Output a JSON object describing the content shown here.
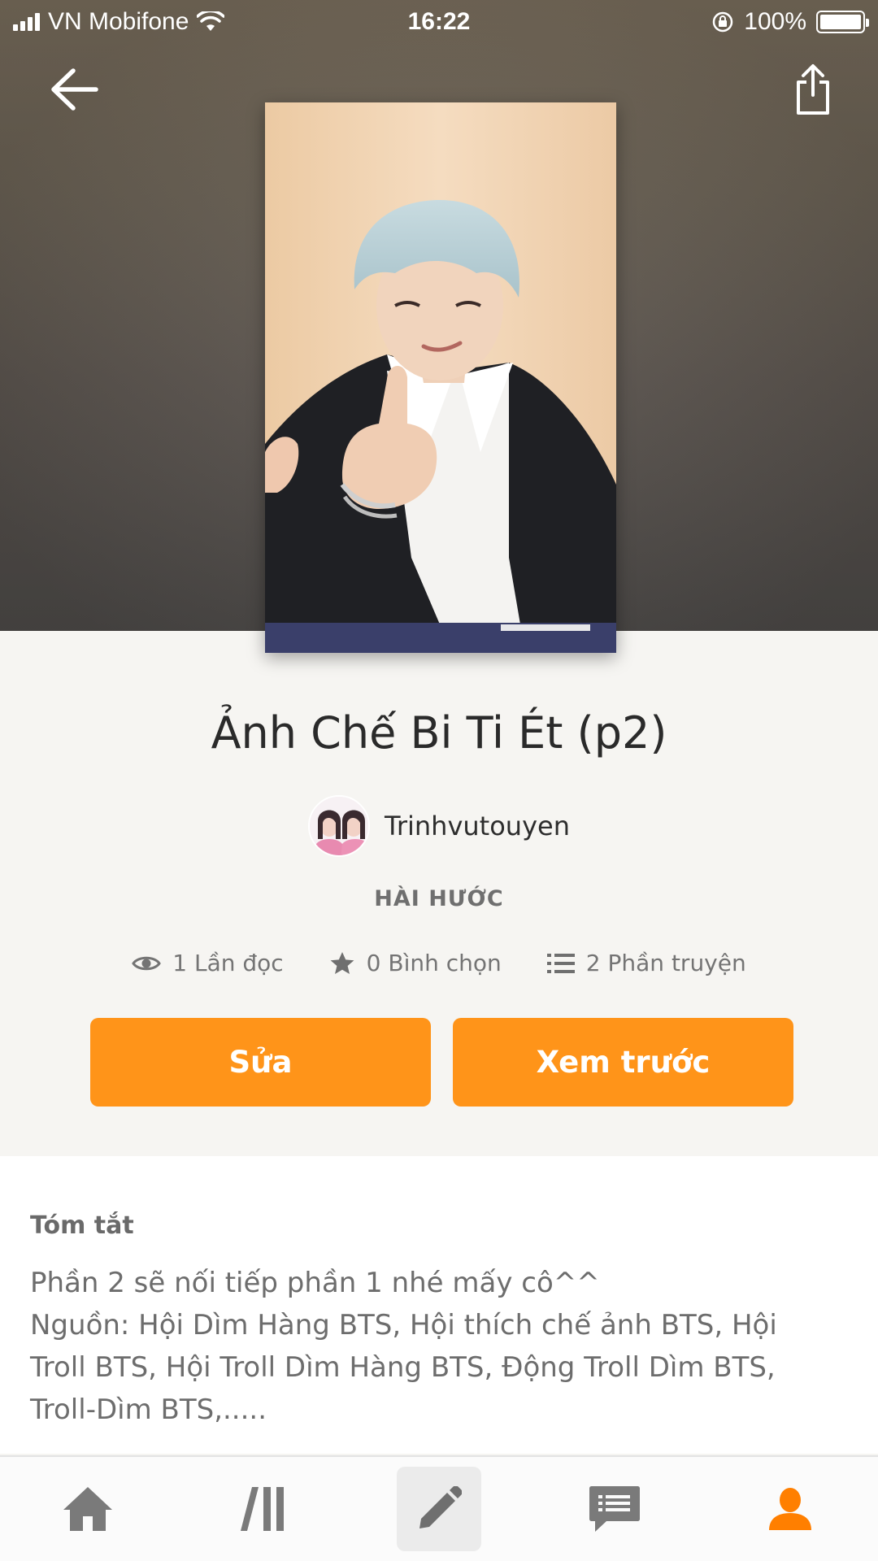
{
  "status_bar": {
    "carrier": "VN Mobifone",
    "time": "16:22",
    "battery": "100%"
  },
  "story": {
    "title": "Ảnh Chế Bi Ti Ét (p2)",
    "author": "Trinhvutouyen",
    "genre": "HÀI HƯỚC",
    "stats": {
      "reads": "1 Lần đọc",
      "votes": "0 Bình chọn",
      "parts": "2 Phần truyện"
    }
  },
  "actions": {
    "edit_label": "Sửa",
    "preview_label": "Xem trước"
  },
  "summary": {
    "label": "Tóm tắt",
    "lines": [
      "Phần 2 sẽ nối tiếp phần 1 nhé mấy cô^^",
      "Nguồn: Hội Dìm Hàng BTS, Hội thích chế ảnh BTS, Hội",
      "Troll BTS, Hội Troll Dìm Hàng BTS, Động Troll Dìm BTS,",
      "Troll-Dìm BTS,....."
    ]
  },
  "tabbar": {
    "items": [
      "home-icon",
      "library-icon",
      "write-icon",
      "messages-icon",
      "profile-icon"
    ],
    "active_color": "#ff7f00",
    "inactive_color": "#7a7a7a"
  },
  "colors": {
    "accent": "#ff9419",
    "background": "#f6f5f2"
  }
}
